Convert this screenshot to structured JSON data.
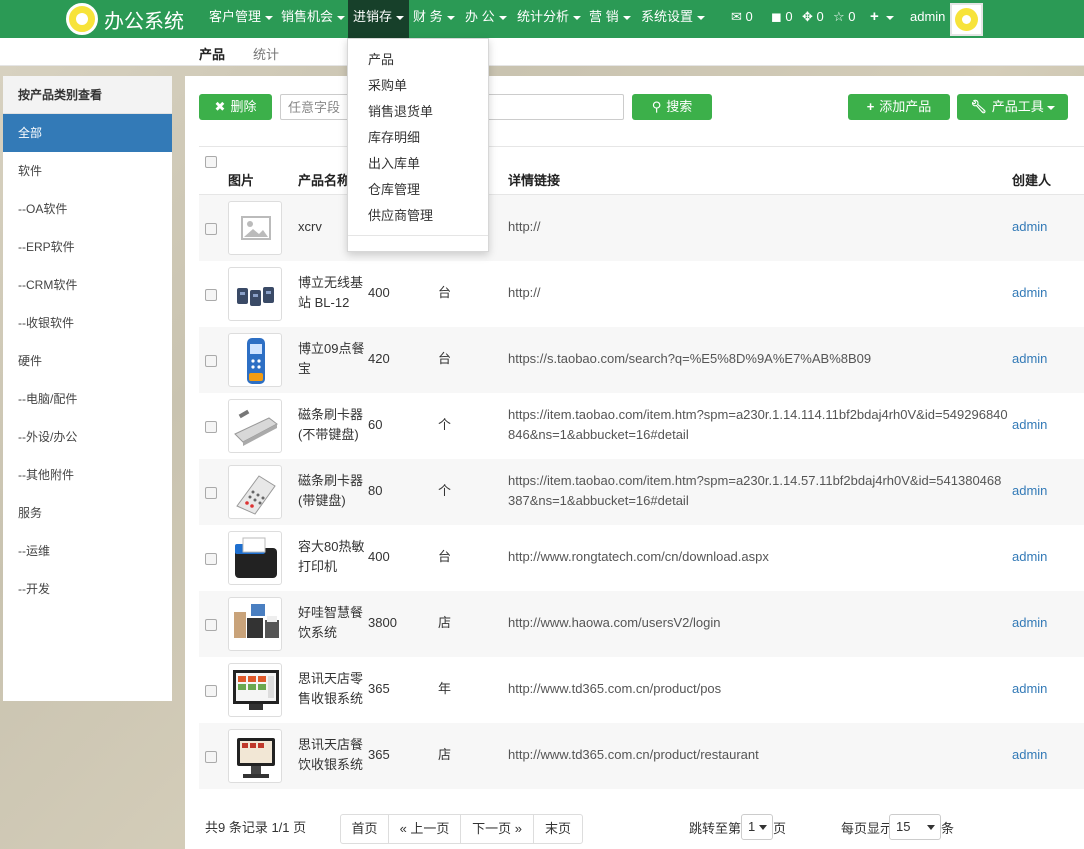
{
  "app": {
    "title": "办公系统"
  },
  "nav": {
    "items": [
      "客户管理",
      "销售机会",
      "进销存",
      "财 务",
      "办 公",
      "统计分析",
      "营 销",
      "系统设置"
    ],
    "mail_count": "0",
    "task_count": "0",
    "share_count": "0",
    "star_count": "0",
    "user": "admin"
  },
  "subnav": {
    "tabs": [
      "产品",
      "统计"
    ]
  },
  "dropdown": {
    "items": [
      "产品",
      "采购单",
      "销售退货单",
      "库存明细",
      "出入库单",
      "仓库管理",
      "供应商管理"
    ]
  },
  "sidebar": {
    "title": "按产品类别查看",
    "items": [
      "全部",
      "软件",
      "--OA软件",
      "--ERP软件",
      "--CRM软件",
      "--收银软件",
      "硬件",
      "--电脑/配件",
      "--外设/办公",
      "--其他附件",
      "服务",
      "--运维",
      "--开发"
    ],
    "active_index": 0
  },
  "toolbar": {
    "delete_label": "删除",
    "search_placeholder": "任意字段",
    "search_label": "搜索",
    "add_label": "添加产品",
    "tools_label": "产品工具"
  },
  "table": {
    "headers": [
      "图片",
      "产品名称",
      "详情链接",
      "创建人"
    ],
    "rows": [
      {
        "name": "xcrv",
        "price": "",
        "unit": "",
        "link": "http://",
        "creator": "admin"
      },
      {
        "name": "博立无线基站 BL-12",
        "price": "400",
        "unit": "台",
        "link": "http://",
        "creator": "admin"
      },
      {
        "name": "博立09点餐宝",
        "price": "420",
        "unit": "台",
        "link": "https://s.taobao.com/search?q=%E5%8D%9A%E7%AB%8B09",
        "creator": "admin"
      },
      {
        "name": "磁条刷卡器(不带键盘)",
        "price": "60",
        "unit": "个",
        "link": "https://item.taobao.com/item.htm?spm=a230r.1.14.114.11bf2bdaj4rh0V&id=549296840846&ns=1&abbucket=16#detail",
        "creator": "admin"
      },
      {
        "name": "磁条刷卡器(带键盘)",
        "price": "80",
        "unit": "个",
        "link": "https://item.taobao.com/item.htm?spm=a230r.1.14.57.11bf2bdaj4rh0V&id=541380468387&ns=1&abbucket=16#detail",
        "creator": "admin"
      },
      {
        "name": "容大80热敏打印机",
        "price": "400",
        "unit": "台",
        "link": "http://www.rongtatech.com/cn/download.aspx",
        "creator": "admin"
      },
      {
        "name": "好哇智慧餐饮系统",
        "price": "3800",
        "unit": "店",
        "link": "http://www.haowa.com/usersV2/login",
        "creator": "admin"
      },
      {
        "name": "思讯天店零售收银系统",
        "price": "365",
        "unit": "年",
        "link": "http://www.td365.com.cn/product/pos",
        "creator": "admin"
      },
      {
        "name": "思讯天店餐饮收银系统",
        "price": "365",
        "unit": "店",
        "link": "http://www.td365.com.cn/product/restaurant",
        "creator": "admin"
      }
    ]
  },
  "pagination": {
    "info": "共9 条记录 1/1 页",
    "first": "首页",
    "prev": "« 上一页",
    "next": "下一页 »",
    "last": "末页",
    "jump_label": "跳转至第",
    "jump_value": "1",
    "jump_suffix": "页",
    "per_page_label": "每页显示",
    "per_page_value": "15",
    "per_page_suffix": "条"
  },
  "colors": {
    "topbar": "#2b9a55",
    "active_nav": "#17402a",
    "button_green": "#3cb04a",
    "sidebar_active": "#337ab7",
    "link_blue": "#337ab7"
  }
}
